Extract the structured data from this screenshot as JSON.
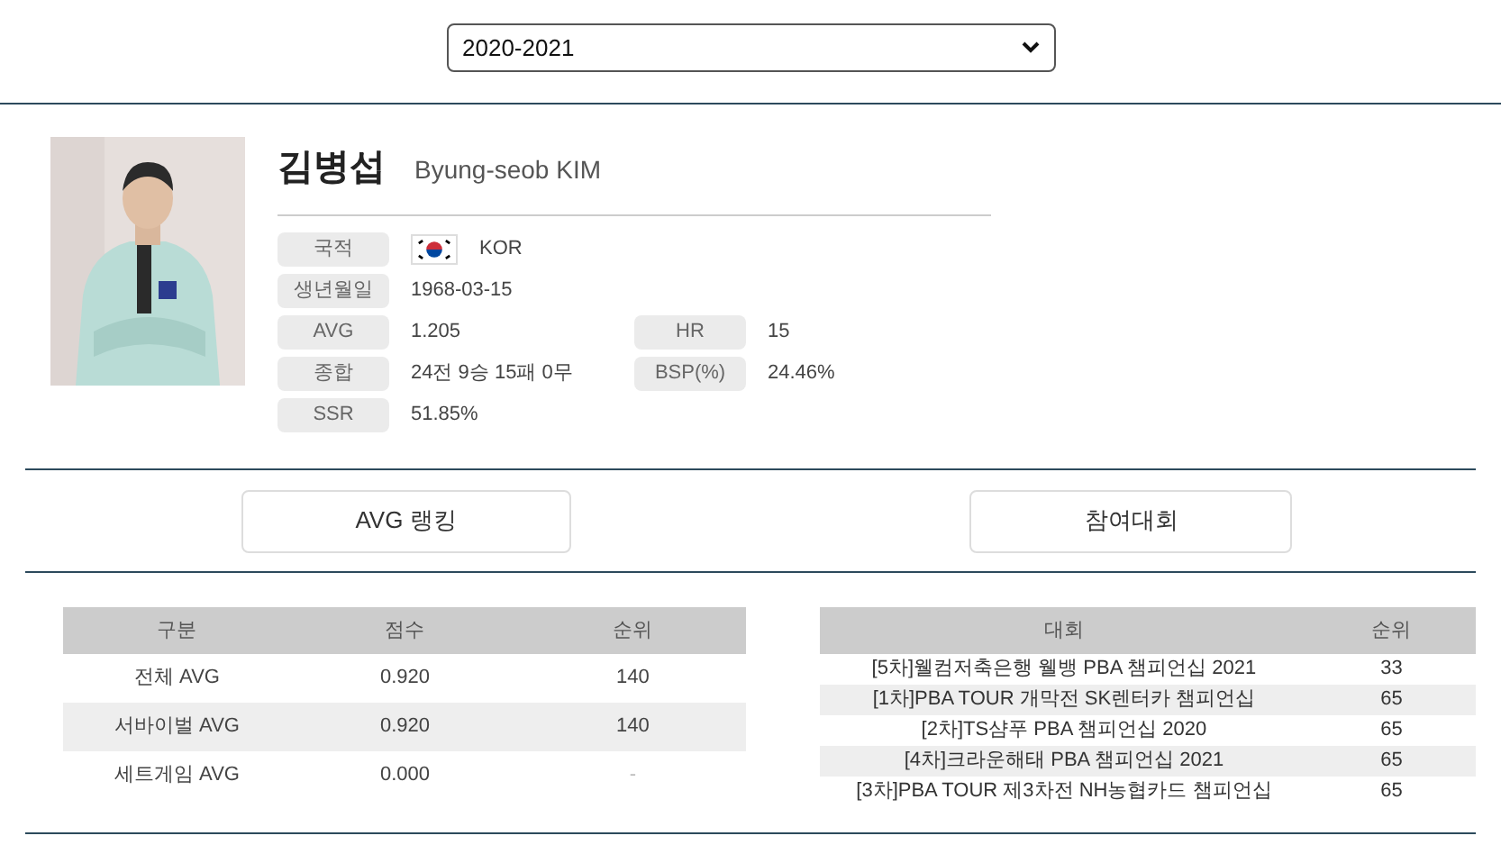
{
  "season_select": {
    "value": "2020-2021"
  },
  "player": {
    "name_kr": "김병섭",
    "name_en": "Byung-seob KIM",
    "info": [
      {
        "label": "국적",
        "value": "KOR",
        "flag": true
      },
      {
        "label": "생년월일",
        "value": "1968-03-15"
      },
      {
        "label": "AVG",
        "value": "1.205",
        "label2": "HR",
        "value2": "15"
      },
      {
        "label": "종합",
        "value": "24전 9승 15패 0무",
        "label2": "BSP(%)",
        "value2": "24.46%"
      },
      {
        "label": "SSR",
        "value": "51.85%"
      }
    ]
  },
  "section_buttons": [
    "AVG 랭킹",
    "참여대회"
  ],
  "ranking_table": {
    "columns": [
      "구분",
      "점수",
      "순위"
    ],
    "rows": [
      [
        "전체 AVG",
        "0.920",
        "140"
      ],
      [
        "서바이벌 AVG",
        "0.920",
        "140"
      ],
      [
        "세트게임 AVG",
        "0.000",
        "-"
      ]
    ]
  },
  "tournament_table": {
    "columns": [
      "대회",
      "순위"
    ],
    "rows": [
      [
        "[5차]웰컴저축은행 웰뱅 PBA 챔피언십 2021",
        "33"
      ],
      [
        "[1차]PBA TOUR 개막전 SK렌터카 챔피언십",
        "65"
      ],
      [
        "[2차]TS샴푸 PBA 챔피언십 2020",
        "65"
      ],
      [
        "[4차]크라운해태 PBA 챔피언십 2021",
        "65"
      ],
      [
        "[3차]PBA TOUR 제3차전 NH농협카드 챔피언십",
        "65"
      ]
    ]
  }
}
